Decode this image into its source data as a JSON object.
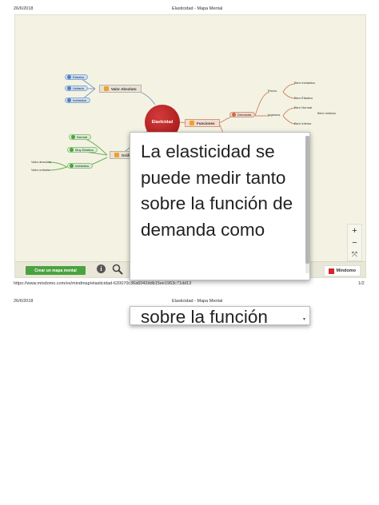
{
  "page1": {
    "date": "26/6/2018",
    "title": "Elasticidad - Mapa Mental",
    "footer_url": "https://www.mindomo.com/es/mindmap/elasticidad-620070c36a6042ddb15ee1963c71dd13",
    "page_number": "1/2"
  },
  "page2": {
    "date": "26/6/2018",
    "title": "Elasticidad - Mapa Mental"
  },
  "mindmap": {
    "root": "Elasticidad",
    "left_top_branch": "Valor Absoluto",
    "left_top_children": [
      "Elástica",
      "Unitaria",
      "Inelástica"
    ],
    "left_bottom_branch": "Gráficas",
    "left_bottom_children": [
      "Normal",
      "Muy Elástica",
      "Inelástica"
    ],
    "left_bottom_sub": [
      "Valor absoluto",
      "Valor unitario"
    ],
    "right_branch": "Funciones",
    "right_sub": [
      "Demanda",
      "Oferta"
    ],
    "right_leaves": [
      "Precio",
      "Ingresos",
      "Costos"
    ],
    "right_far_leaves": [
      "Bien Inelástico",
      "Bien Elástico",
      "Bien Normal",
      "Bien Inferior",
      "Bien Unitario"
    ]
  },
  "toolbar": {
    "create_label": "Crear un mapa mental",
    "brand": "Mindomo"
  },
  "zoom": {
    "plus": "+",
    "minus": "−",
    "fit": "⤧"
  },
  "popup": {
    "text": "La elasticidad se puede medir tanto sobre la función de demanda como",
    "continued_text": "sobre la función"
  },
  "colors": {
    "root": "#b71c1c",
    "accent_green": "#4aa33e",
    "brand_red": "#d4262b"
  }
}
